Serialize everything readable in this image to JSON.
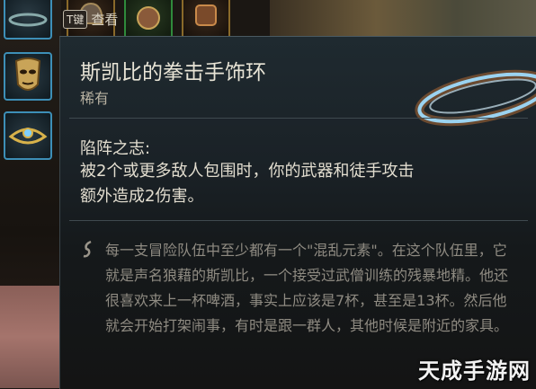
{
  "hint": {
    "key": "T键",
    "action": "查看"
  },
  "item": {
    "name": "斯凯比的拳击手饰环",
    "rarity": "稀有",
    "passive_title": "陷阵之志:",
    "passive_text": "被2个或更多敌人包围时，你的武器和徒手攻击额外造成2伤害。",
    "lore": "每一支冒险队伍中至少都有一个\"混乱元素\"。在这个队伍里，它就是声名狼藉的斯凯比，一个接受过武僧训练的残暴地精。他还很喜欢来上一杯啤酒，事实上应该是7杯，甚至是13杯。然后他就会开始打架闹事，有时是跟一群人，其他时候是附近的家具。"
  },
  "watermark": "天成手游网",
  "icons": [
    "bracelet-icon",
    "mask-icon",
    "amulet-icon",
    "helmet-icon",
    "quote-icon"
  ],
  "colors": {
    "slot_border_blue": "#3d8fb7",
    "slot_border_gold": "#8a6a2a",
    "title_text": "#e8e4d6",
    "lore_text": "#8f8b82"
  }
}
